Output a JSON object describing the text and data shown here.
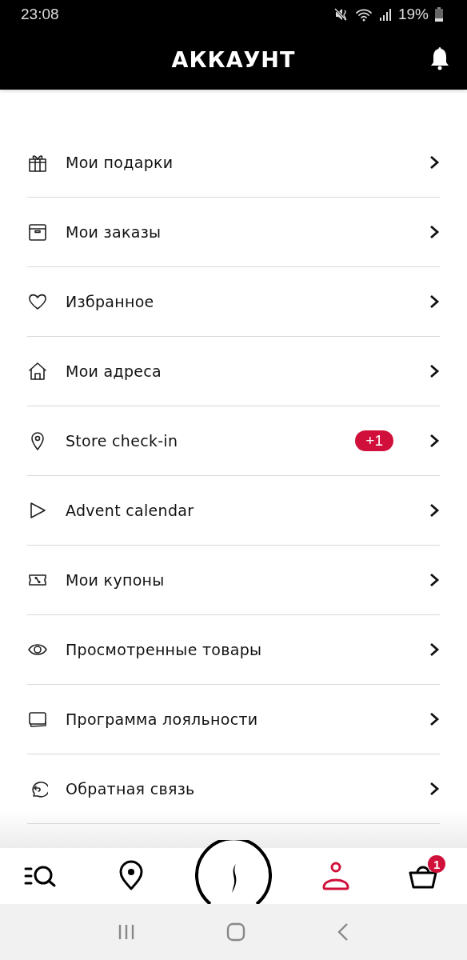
{
  "status_bar": {
    "time": "23:08",
    "battery": "19%"
  },
  "header": {
    "title": "АККАУНТ"
  },
  "menu": [
    {
      "label": "Мои подарки"
    },
    {
      "label": "Мои заказы"
    },
    {
      "label": "Избранное"
    },
    {
      "label": "Мои адреса"
    },
    {
      "label": "Store check-in",
      "badge": "+1"
    },
    {
      "label": "Advent calendar"
    },
    {
      "label": "Мои купоны"
    },
    {
      "label": "Просмотренные товары"
    },
    {
      "label": "Программа лояльности"
    },
    {
      "label": "Обратная связь"
    }
  ],
  "bottom_nav": [
    {
      "kind": "search",
      "selected": false
    },
    {
      "kind": "stores",
      "selected": false
    },
    {
      "kind": "logo",
      "selected": false
    },
    {
      "kind": "account",
      "selected": true
    },
    {
      "kind": "basket",
      "selected": false,
      "badge": "1"
    }
  ]
}
